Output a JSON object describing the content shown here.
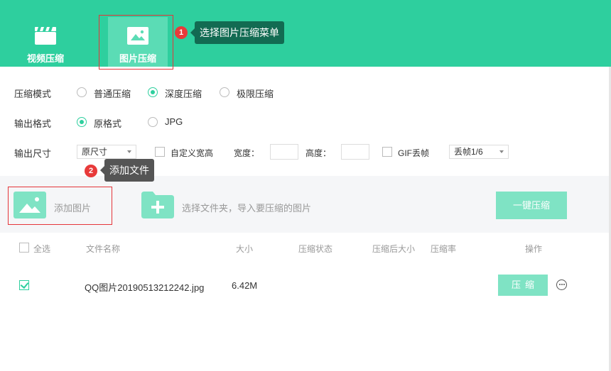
{
  "header": {
    "tabs": [
      {
        "label": "视频压缩",
        "icon": "clapperboard-icon"
      },
      {
        "label": "图片压缩",
        "icon": "image-icon",
        "active": true
      }
    ],
    "accent": "#2ecf9e"
  },
  "annotations": [
    {
      "badge": "1",
      "text": "选择图片压缩菜单"
    },
    {
      "badge": "2",
      "text": "添加文件"
    }
  ],
  "settings": {
    "mode": {
      "label": "压缩模式",
      "options": [
        {
          "label": "普通压缩",
          "checked": false
        },
        {
          "label": "深度压缩",
          "checked": true
        },
        {
          "label": "极限压缩",
          "checked": false
        }
      ]
    },
    "format": {
      "label": "输出格式",
      "options": [
        {
          "label": "原格式",
          "checked": true
        },
        {
          "label": "JPG",
          "checked": false
        }
      ]
    },
    "size": {
      "label": "输出尺寸",
      "size_select": "原尺寸",
      "custom_label": "自定义宽高",
      "width_label": "宽度：",
      "height_label": "高度：",
      "width_value": "",
      "height_value": "",
      "gif_label": "GIF丢帧",
      "gif_select": "丢帧1/6"
    }
  },
  "add_area": {
    "add_image": "添加图片",
    "add_folder": "选择文件夹，导入要压缩的图片",
    "compress_all": "一键压缩"
  },
  "table": {
    "columns": [
      "全选",
      "文件名称",
      "大小",
      "压缩状态",
      "压缩后大小",
      "压缩率",
      "操作"
    ],
    "rows": [
      {
        "checked": true,
        "name": "QQ图片20190513212242.jpg",
        "size": "6.42M",
        "status": "",
        "after": "",
        "rate": "",
        "action": "压缩"
      }
    ]
  }
}
